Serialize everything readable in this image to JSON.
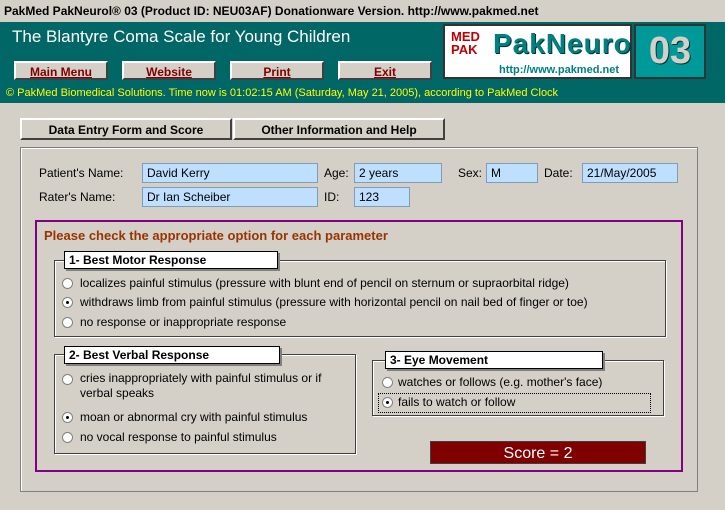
{
  "window": {
    "title": "PakMed PakNeurol® 03 (Product ID: NEU03AF) Donationware Version. http://www.pakmed.net"
  },
  "header": {
    "app_title": "The Blantyre Coma Scale for Young Children",
    "buttons": [
      "Main Menu",
      "Website",
      "Print",
      "Exit"
    ],
    "logo": {
      "med": "MED PAK",
      "name": "PakNeurol®",
      "url": "http://www.pakmed.net",
      "version": "03"
    },
    "status": "© PakMed Biomedical Solutions. Time now is 01:02:15 AM (Saturday, May 21, 2005), according to PakMed Clock"
  },
  "tabs": [
    "Data Entry Form and Score",
    "Other Information and Help"
  ],
  "patient": {
    "name_label": "Patient's Name:",
    "name": "David Kerry",
    "age_label": "Age:",
    "age": "2 years",
    "sex_label": "Sex:",
    "sex": "M",
    "date_label": "Date:",
    "date": "21/May/2005",
    "rater_label": "Rater's Name:",
    "rater": "Dr Ian Scheiber",
    "id_label": "ID:",
    "id": "123"
  },
  "instruction": "Please check the appropriate option for each parameter",
  "motor": {
    "title": "1- Best Motor Response",
    "options": [
      "localizes painful stimulus (pressure with blunt end of pencil on sternum or supraorbital ridge)",
      "withdraws limb from painful stimulus (pressure with horizontal pencil on nail bed of finger or toe)",
      "no response or inappropriate response"
    ],
    "selected": 1
  },
  "verbal": {
    "title": "2- Best Verbal Response",
    "options": [
      "cries inappropriately with painful stimulus or if verbal speaks",
      "moan or abnormal cry with painful stimulus",
      "no vocal response to painful stimulus"
    ],
    "selected": 1
  },
  "eye": {
    "title": "3- Eye Movement",
    "options": [
      "watches or follows (e.g. mother's face)",
      "fails to watch or follow"
    ],
    "selected": 1
  },
  "score": "Score = 2"
}
